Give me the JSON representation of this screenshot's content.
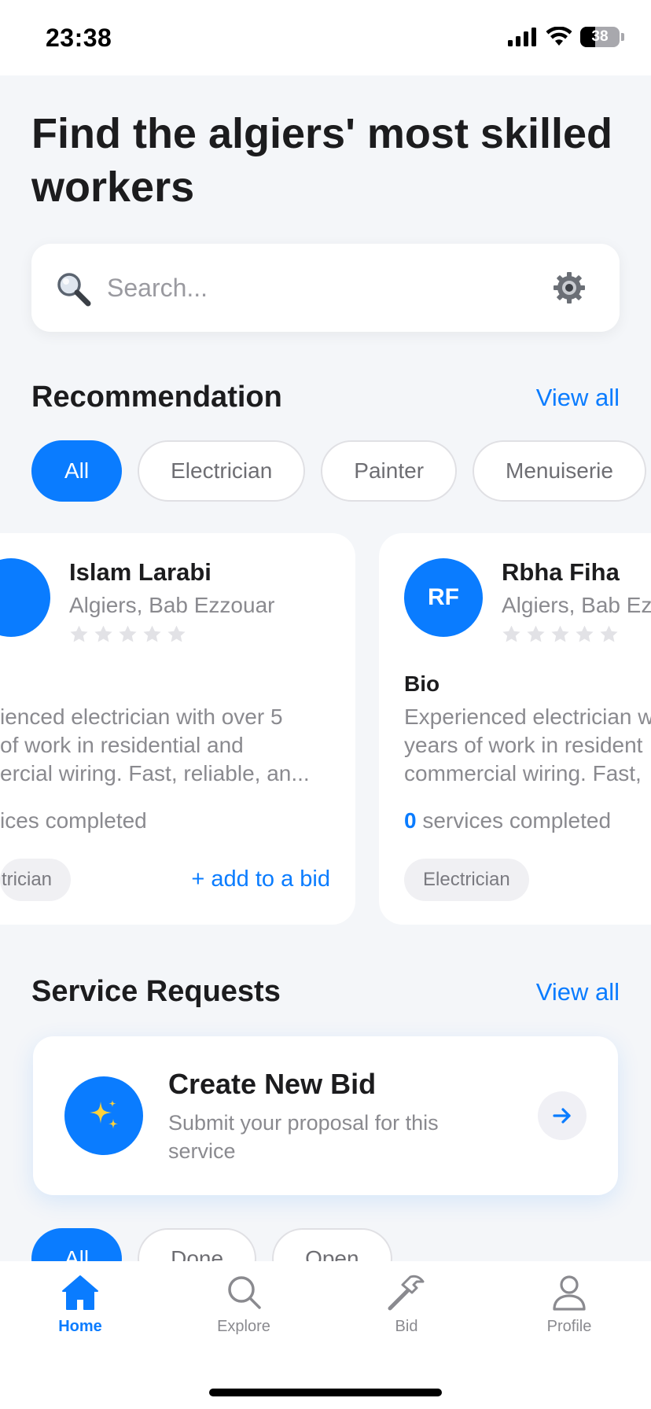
{
  "status_bar": {
    "time": "23:38",
    "battery": "38",
    "battery_level": 0.38
  },
  "header": {
    "title": "Find the algiers' most skilled workers"
  },
  "search": {
    "placeholder": "Search..."
  },
  "recommendation": {
    "title": "Recommendation",
    "view_all": "View all",
    "filters": [
      "All",
      "Electrician",
      "Painter",
      "Menuiserie"
    ],
    "active_filter": "All"
  },
  "workers": [
    {
      "initials": "",
      "name": "Islam Larabi",
      "location": "Algiers, Bab Ezzouar",
      "rating": 0,
      "bio_label": "",
      "bio_lines": [
        "ienced electrician with over 5",
        "of work in residential and",
        "ercial wiring. Fast, reliable, an..."
      ],
      "completed_count": "",
      "completed_text": "ices completed",
      "tag": "trician",
      "action": "+ add to a bid"
    },
    {
      "initials": "RF",
      "name": "Rbha Fiha",
      "location": "Algiers, Bab Ez",
      "rating": 0,
      "bio_label": "Bio",
      "bio_lines": [
        "Experienced electrician w",
        "years of work in resident",
        "commercial wiring. Fast,"
      ],
      "completed_count": "0",
      "completed_text": " services completed",
      "tag": "Electrician",
      "action": ""
    }
  ],
  "service_requests": {
    "title": "Service Requests",
    "view_all": "View all",
    "create_bid": {
      "title": "Create New Bid",
      "subtitle": "Submit your proposal for this service",
      "icon": "sparkles-icon"
    },
    "filters": [
      "All",
      "Done",
      "Open"
    ]
  },
  "tab_bar": {
    "tabs": [
      {
        "label": "Home",
        "icon": "home-icon",
        "active": true
      },
      {
        "label": "Explore",
        "icon": "search-icon",
        "active": false
      },
      {
        "label": "Bid",
        "icon": "hammer-icon",
        "active": false
      },
      {
        "label": "Profile",
        "icon": "person-icon",
        "active": false
      }
    ]
  },
  "colors": {
    "accent": "#0a7cff",
    "background": "#f4f6f9",
    "muted": "#8a8a8f"
  }
}
